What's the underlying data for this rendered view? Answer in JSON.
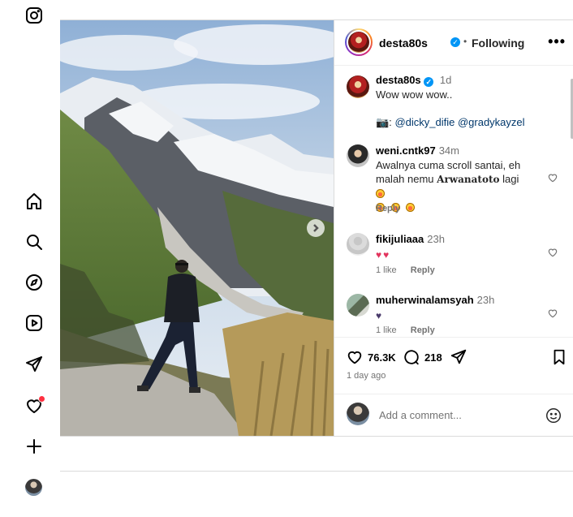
{
  "nav": {
    "items": [
      "instagram",
      "home",
      "search",
      "explore",
      "reels",
      "messages",
      "notifications",
      "create",
      "profile"
    ]
  },
  "post": {
    "author": "desta80s",
    "follow_dot": "•",
    "follow_label": "Following",
    "more": "•••",
    "caption": {
      "username": "desta80s",
      "time": "1d",
      "line1": "Wow wow wow..",
      "camera_emoji": "📷:",
      "mention1": "@dicky_difie",
      "mention2": "@gradykayzel"
    },
    "comments": [
      {
        "username": "weni.cntk97",
        "time": "34m",
        "text_before": "Awalnya cuma scroll santai, eh malah nemu",
        "text_bold": "Arwanatoto",
        "text_after": "lagi",
        "reply": "Reply"
      },
      {
        "username": "fikijuliaaa",
        "time": "23h",
        "likes": "1 like",
        "reply": "Reply"
      },
      {
        "username": "muherwinalamsyah",
        "time": "23h",
        "likes": "1 like",
        "reply": "Reply"
      }
    ],
    "likes_count": "76.3K",
    "comments_count": "218",
    "posted_ago": "1 day ago",
    "add_comment_placeholder": "Add a comment..."
  },
  "colors": {
    "accent": "#0095f6",
    "notification_dot": "#ff3040",
    "link": "#00376b"
  }
}
